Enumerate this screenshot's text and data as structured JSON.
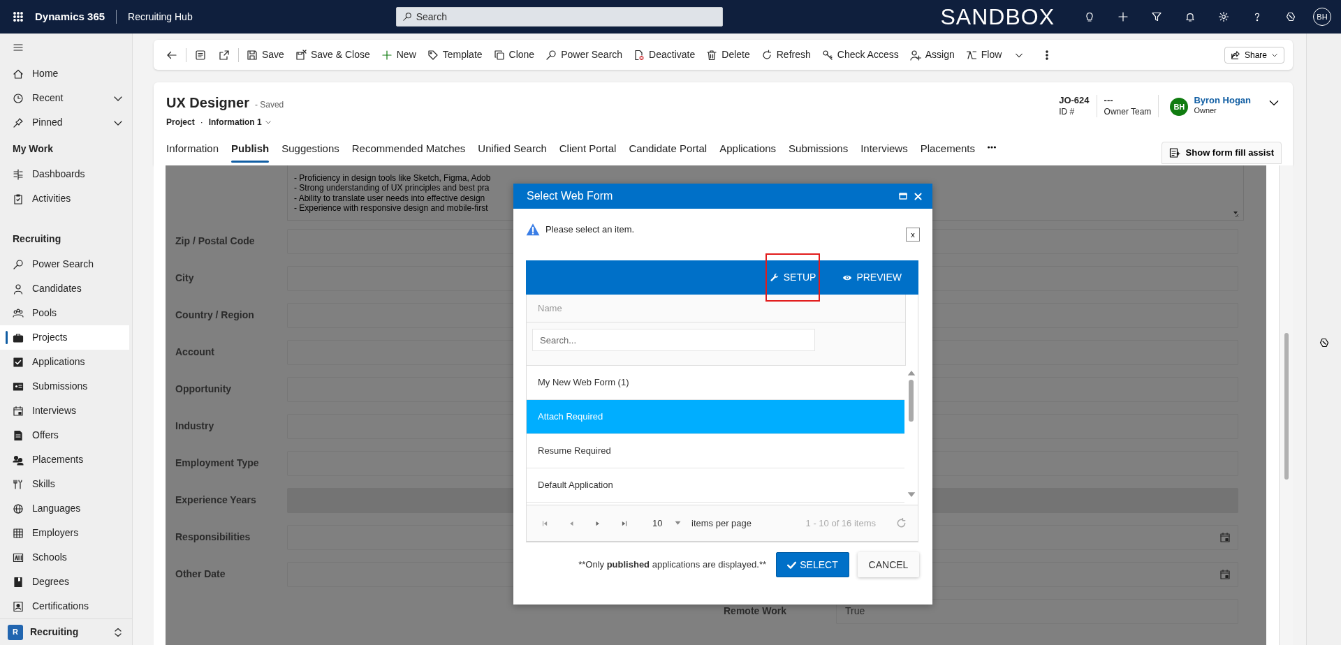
{
  "top_bar": {
    "app_name": "Dynamics 365",
    "area_name": "Recruiting Hub",
    "search_placeholder": "Search",
    "environment": "SANDBOX",
    "avatar": "BH"
  },
  "command_bar": {
    "commands": [
      {
        "label": "Save",
        "has_menu": false
      },
      {
        "label": "Save & Close",
        "has_menu": false
      },
      {
        "label": "New",
        "has_menu": false
      },
      {
        "label": "Template",
        "has_menu": false
      },
      {
        "label": "Clone",
        "has_menu": false
      },
      {
        "label": "Power Search",
        "has_menu": false
      },
      {
        "label": "Deactivate",
        "has_menu": false
      },
      {
        "label": "Delete",
        "has_menu": false
      },
      {
        "label": "Refresh",
        "has_menu": false
      },
      {
        "label": "Check Access",
        "has_menu": false
      },
      {
        "label": "Assign",
        "has_menu": false
      },
      {
        "label": "Flow",
        "has_menu": true
      }
    ],
    "share": "Share"
  },
  "sidebar": {
    "top_items": [
      {
        "label": "Home",
        "expandable": false
      },
      {
        "label": "Recent",
        "expandable": true
      },
      {
        "label": "Pinned",
        "expandable": true
      }
    ],
    "groups": [
      {
        "title": "My Work",
        "items": [
          {
            "label": "Dashboards",
            "selected": false
          },
          {
            "label": "Activities",
            "selected": false
          }
        ]
      },
      {
        "title": "Recruiting",
        "items": [
          {
            "label": "Power Search",
            "selected": false
          },
          {
            "label": "Candidates",
            "selected": false
          },
          {
            "label": "Pools",
            "selected": false
          },
          {
            "label": "Projects",
            "selected": true
          },
          {
            "label": "Applications",
            "selected": false
          },
          {
            "label": "Submissions",
            "selected": false
          },
          {
            "label": "Interviews",
            "selected": false
          },
          {
            "label": "Offers",
            "selected": false
          },
          {
            "label": "Placements",
            "selected": false
          },
          {
            "label": "Skills",
            "selected": false
          },
          {
            "label": "Languages",
            "selected": false
          },
          {
            "label": "Employers",
            "selected": false
          },
          {
            "label": "Schools",
            "selected": false
          },
          {
            "label": "Degrees",
            "selected": false
          },
          {
            "label": "Certifications",
            "selected": false
          }
        ]
      }
    ],
    "area_switcher": {
      "badge": "R",
      "label": "Recruiting"
    }
  },
  "record": {
    "title": "UX Designer",
    "save_status": "- Saved",
    "entity": "Project",
    "entity_separator": "·",
    "form_name": "Information 1",
    "header_fields": [
      {
        "value": "JO-624",
        "label": "ID #"
      },
      {
        "value": "---",
        "label": "Owner Team"
      }
    ],
    "owner": {
      "initials": "BH",
      "name": "Byron Hogan",
      "label": "Owner"
    },
    "tabs": [
      {
        "label": "Information",
        "selected": false
      },
      {
        "label": "Publish",
        "selected": true
      },
      {
        "label": "Suggestions",
        "selected": false
      },
      {
        "label": "Recommended Matches",
        "selected": false
      },
      {
        "label": "Unified Search",
        "selected": false
      },
      {
        "label": "Client Portal",
        "selected": false
      },
      {
        "label": "Candidate Portal",
        "selected": false
      },
      {
        "label": "Applications",
        "selected": false
      },
      {
        "label": "Submissions",
        "selected": false
      },
      {
        "label": "Interviews",
        "selected": false
      },
      {
        "label": "Placements",
        "selected": false
      }
    ],
    "form_fill_assist": "Show form fill assist"
  },
  "form": {
    "description_lines": [
      "- Proficiency in design tools like Sketch, Figma, Adob",
      "- Strong understanding of UX principles and best pra",
      "- Ability to translate user needs into effective design",
      "- Experience with responsive design and mobile-first"
    ],
    "fields": [
      {
        "label": "Zip / Postal Code",
        "kind": "text"
      },
      {
        "label": "City",
        "kind": "text"
      },
      {
        "label": "Country / Region",
        "kind": "text"
      },
      {
        "label": "Account",
        "kind": "text"
      },
      {
        "label": "Opportunity",
        "kind": "text"
      },
      {
        "label": "Industry",
        "kind": "text"
      },
      {
        "label": "Employment Type",
        "kind": "text"
      },
      {
        "label": "Experience Years",
        "kind": "disabled"
      },
      {
        "label": "Responsibilities",
        "kind": "date"
      },
      {
        "label": "Other Date",
        "kind": "date"
      }
    ],
    "remote_work": {
      "label": "Remote Work",
      "value": "True"
    }
  },
  "dialog": {
    "title": "Select Web Form",
    "alert": "Please select an item.",
    "alert_close": "x",
    "toolbar": [
      {
        "label": "SETUP",
        "highlighted": true
      },
      {
        "label": "PREVIEW",
        "highlighted": false
      }
    ],
    "column": "Name",
    "search_placeholder": "Search...",
    "rows": [
      {
        "name": "My New Web Form (1)",
        "selected": false
      },
      {
        "name": "Attach Required",
        "selected": true
      },
      {
        "name": "Resume Required",
        "selected": false
      },
      {
        "name": "Default Application",
        "selected": false
      }
    ],
    "pager": {
      "page_size": "10",
      "per_page_label": "items per page",
      "summary": "1 - 10 of 16 items"
    },
    "note_before": "**Only ",
    "note_bold": "published",
    "note_after": " applications are displayed.**",
    "select": "SELECT",
    "cancel": "CANCEL"
  }
}
